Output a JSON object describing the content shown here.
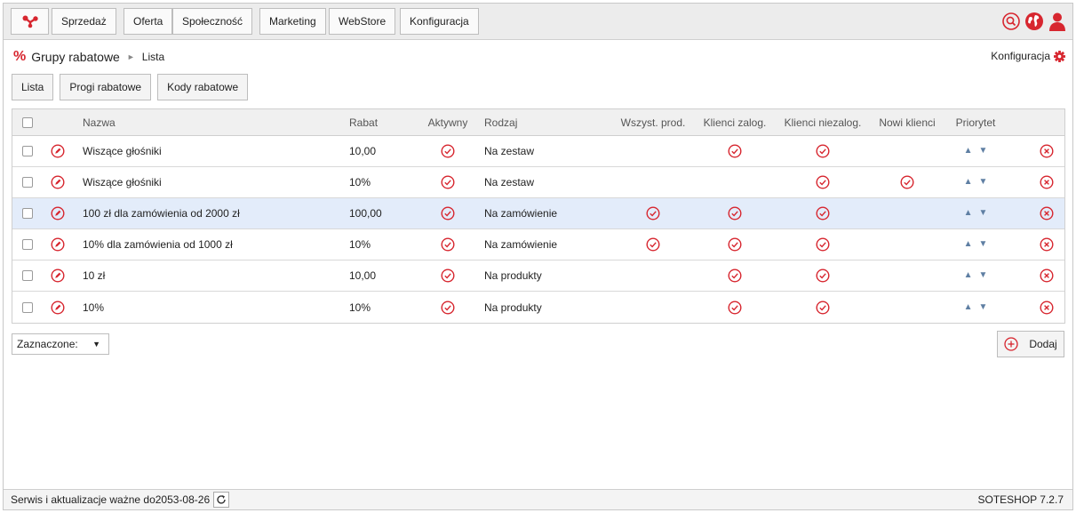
{
  "colors": {
    "accent": "#d7262f",
    "arrow": "#5f7fa3",
    "selected_row": "#e3ecfa"
  },
  "nav": {
    "logo_icon": "share-nodes-icon",
    "items": [
      {
        "label": "Sprzedaż"
      },
      {
        "label": "Oferta"
      },
      {
        "label": "Społeczność"
      },
      {
        "label": "Marketing"
      },
      {
        "label": "WebStore"
      },
      {
        "label": "Konfiguracja"
      }
    ],
    "icons": [
      "search-icon",
      "globe-icon",
      "user-icon"
    ]
  },
  "header": {
    "section_icon": "percent-icon",
    "section_glyph": "%",
    "title": "Grupy rabatowe",
    "separator": "►",
    "subtitle": "Lista",
    "config_label": "Konfiguracja"
  },
  "tabs": [
    {
      "label": "Lista"
    },
    {
      "label": "Progi rabatowe"
    },
    {
      "label": "Kody rabatowe"
    }
  ],
  "table": {
    "columns": {
      "name": "Nazwa",
      "discount": "Rabat",
      "active": "Aktywny",
      "type": "Rodzaj",
      "all_products": "Wszyst. prod.",
      "logged": "Klienci zalog.",
      "not_logged": "Klienci niezalog.",
      "new_clients": "Nowi klienci",
      "priority": "Priorytet"
    },
    "rows": [
      {
        "name": "Wiszące głośniki",
        "discount": "10,00",
        "active": true,
        "type": "Na zestaw",
        "all_products": false,
        "logged": true,
        "not_logged": true,
        "new_clients": false,
        "selected": false
      },
      {
        "name": "Wiszące głośniki",
        "discount": "10%",
        "active": true,
        "type": "Na zestaw",
        "all_products": false,
        "logged": false,
        "not_logged": true,
        "new_clients": true,
        "selected": false
      },
      {
        "name": "100 zł dla zamówienia od 2000 zł",
        "discount": "100,00",
        "active": true,
        "type": "Na zamówienie",
        "all_products": true,
        "logged": true,
        "not_logged": true,
        "new_clients": false,
        "selected": true
      },
      {
        "name": "10% dla zamówienia od 1000 zł",
        "discount": "10%",
        "active": true,
        "type": "Na zamówienie",
        "all_products": true,
        "logged": true,
        "not_logged": true,
        "new_clients": false,
        "selected": false
      },
      {
        "name": "10 zł",
        "discount": "10,00",
        "active": true,
        "type": "Na produkty",
        "all_products": false,
        "logged": true,
        "not_logged": true,
        "new_clients": false,
        "selected": false
      },
      {
        "name": "10%",
        "discount": "10%",
        "active": true,
        "type": "Na produkty",
        "all_products": false,
        "logged": true,
        "not_logged": true,
        "new_clients": false,
        "selected": false
      }
    ]
  },
  "bulk_action": {
    "label": "Zaznaczone:",
    "caret": "▼"
  },
  "add_button": {
    "label": "Dodaj"
  },
  "footer": {
    "service_text": "Serwis i aktualizacje ważne do2053-08-26",
    "version": "SOTESHOP 7.2.7"
  }
}
